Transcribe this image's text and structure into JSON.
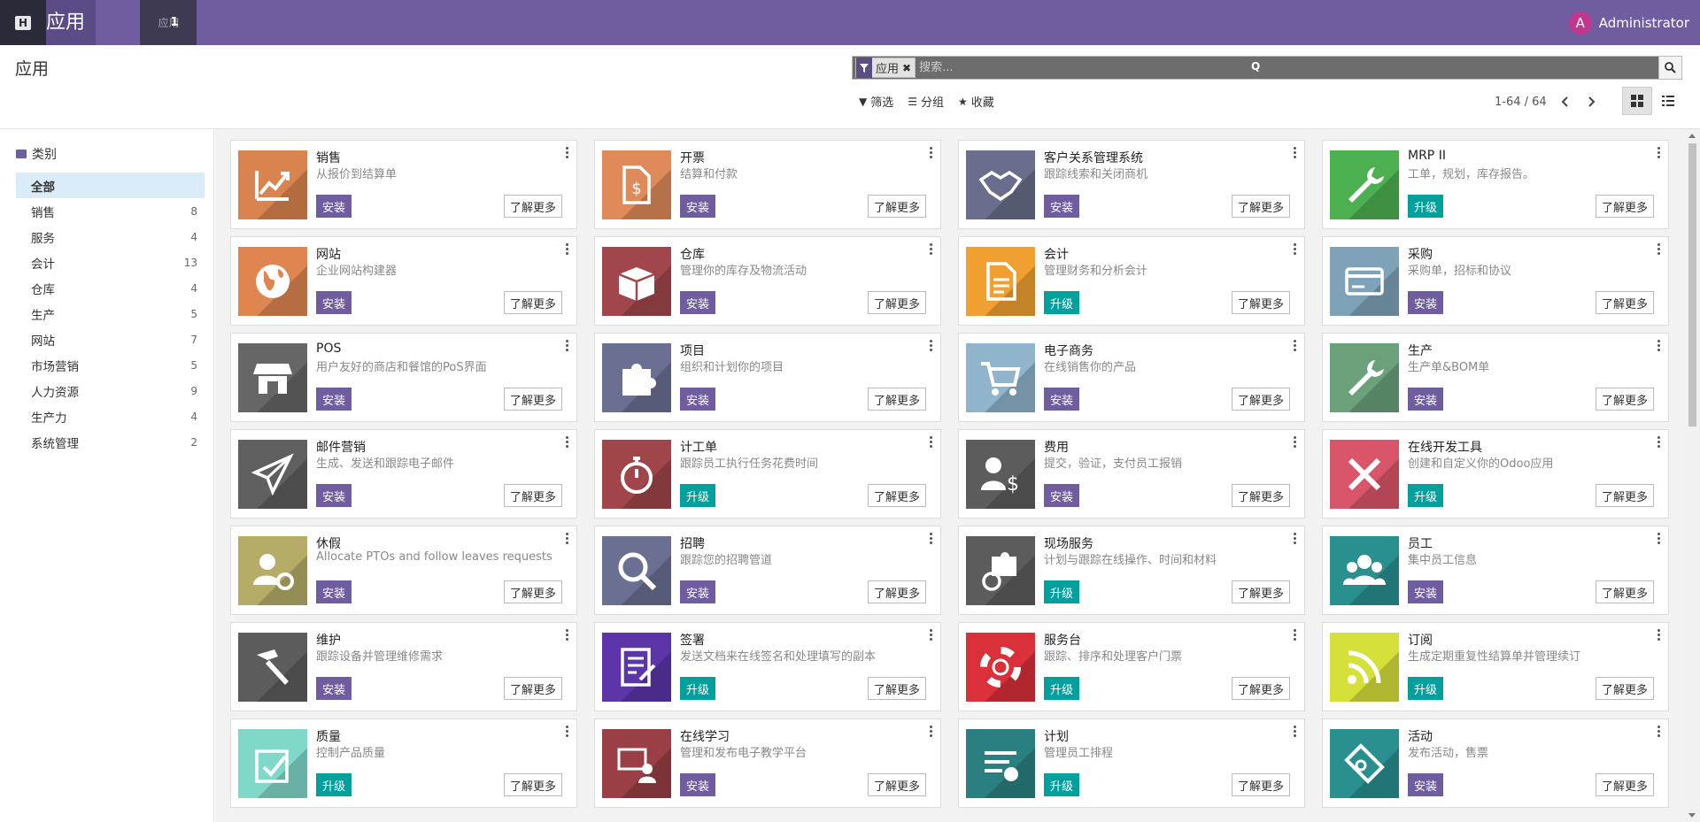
{
  "navbar": {
    "home_icon": "H",
    "title": "应用",
    "tab_label": "应用",
    "tab_badge": "1",
    "user_initial": "A",
    "user_name": "Administrator"
  },
  "control": {
    "page_title": "应用",
    "facet_label": "应用",
    "search_placeholder": "搜索...",
    "search_hint": "Q",
    "filters": [
      {
        "label": "筛选",
        "icon": "filter-icon"
      },
      {
        "label": "分组",
        "icon": "list-icon"
      },
      {
        "label": "收藏",
        "icon": "star-icon"
      }
    ],
    "pager": "1-64 / 64"
  },
  "sidebar": {
    "heading": "类别",
    "items": [
      {
        "label": "全部",
        "count": ""
      },
      {
        "label": "销售",
        "count": "8"
      },
      {
        "label": "服务",
        "count": "4"
      },
      {
        "label": "会计",
        "count": "13"
      },
      {
        "label": "仓库",
        "count": "4"
      },
      {
        "label": "生产",
        "count": "5"
      },
      {
        "label": "网站",
        "count": "7"
      },
      {
        "label": "市场营销",
        "count": "5"
      },
      {
        "label": "人力资源",
        "count": "9"
      },
      {
        "label": "生产力",
        "count": "4"
      },
      {
        "label": "系统管理",
        "count": "2"
      }
    ]
  },
  "apps": [
    {
      "name": "销售",
      "desc": "从报价到结算单",
      "action": "安装",
      "type": "install",
      "more": "了解更多",
      "color": "#d9844e",
      "icon": "chart-icon"
    },
    {
      "name": "开票",
      "desc": "结算和付款",
      "action": "安装",
      "type": "install",
      "more": "了解更多",
      "color": "#e08a5a",
      "icon": "invoice-icon"
    },
    {
      "name": "客户关系管理系统",
      "desc": "跟踪线索和关闭商机",
      "action": "安装",
      "type": "install",
      "more": "了解更多",
      "color": "#6a6d8c",
      "icon": "handshake-icon"
    },
    {
      "name": "MRP II",
      "desc": "工单，规划，库存报告。",
      "action": "升级",
      "type": "upgrade",
      "more": "了解更多",
      "color": "#4caf50",
      "icon": "wrench-icon"
    },
    {
      "name": "网站",
      "desc": "企业网站构建器",
      "action": "安装",
      "type": "install",
      "more": "了解更多",
      "color": "#de8550",
      "icon": "globe-icon"
    },
    {
      "name": "仓库",
      "desc": "管理你的库存及物流活动",
      "action": "安装",
      "type": "install",
      "more": "了解更多",
      "color": "#a1464a",
      "icon": "box-icon"
    },
    {
      "name": "会计",
      "desc": "管理财务和分析会计",
      "action": "升级",
      "type": "upgrade",
      "more": "了解更多",
      "color": "#f0a030",
      "icon": "document-icon"
    },
    {
      "name": "采购",
      "desc": "采购单，招标和协议",
      "action": "安装",
      "type": "install",
      "more": "了解更多",
      "color": "#7ea3b8",
      "icon": "card-icon"
    },
    {
      "name": "POS",
      "desc": "用户友好的商店和餐馆的PoS界面",
      "action": "安装",
      "type": "install",
      "more": "了解更多",
      "color": "#666",
      "icon": "shop-icon"
    },
    {
      "name": "项目",
      "desc": "组织和计划你的项目",
      "action": "安装",
      "type": "install",
      "more": "了解更多",
      "color": "#6b6f92",
      "icon": "puzzle-icon"
    },
    {
      "name": "电子商务",
      "desc": "在线销售你的产品",
      "action": "安装",
      "type": "install",
      "more": "了解更多",
      "color": "#8fb4cc",
      "icon": "cart-icon"
    },
    {
      "name": "生产",
      "desc": "生产单&BOM单",
      "action": "安装",
      "type": "install",
      "more": "了解更多",
      "color": "#6aa07a",
      "icon": "wrench-icon"
    },
    {
      "name": "邮件营销",
      "desc": "生成、发送和跟踪电子邮件",
      "action": "安装",
      "type": "install",
      "more": "了解更多",
      "color": "#5f5f5f",
      "icon": "paper-plane-icon"
    },
    {
      "name": "计工单",
      "desc": "跟踪员工执行任务花费时间",
      "action": "升级",
      "type": "upgrade",
      "more": "了解更多",
      "color": "#a0464a",
      "icon": "stopwatch-icon"
    },
    {
      "name": "费用",
      "desc": "提交，验证，支付员工报销",
      "action": "安装",
      "type": "install",
      "more": "了解更多",
      "color": "#5c5c5c",
      "icon": "user-dollar-icon"
    },
    {
      "name": "在线开发工具",
      "desc": "创建和自定义你的Odoo应用",
      "action": "升级",
      "type": "upgrade",
      "more": "了解更多",
      "color": "#d9556a",
      "icon": "tools-icon"
    },
    {
      "name": "休假",
      "desc": "Allocate PTOs and follow leaves requests",
      "action": "安装",
      "type": "install",
      "more": "了解更多",
      "color": "#b5ac68",
      "icon": "user-gear-icon"
    },
    {
      "name": "招聘",
      "desc": "跟踪您的招聘管道",
      "action": "安装",
      "type": "install",
      "more": "了解更多",
      "color": "#6b6f92",
      "icon": "magnifier-icon"
    },
    {
      "name": "现场服务",
      "desc": "计划与跟踪在线操作、时间和材料",
      "action": "升级",
      "type": "upgrade",
      "more": "了解更多",
      "color": "#5c5c5c",
      "icon": "puzzle-clock-icon"
    },
    {
      "name": "员工",
      "desc": "集中员工信息",
      "action": "安装",
      "type": "install",
      "more": "了解更多",
      "color": "#2a8f8f",
      "icon": "group-icon"
    },
    {
      "name": "维护",
      "desc": "跟踪设备并管理维修需求",
      "action": "安装",
      "type": "install",
      "more": "了解更多",
      "color": "#5c5c5c",
      "icon": "hammer-icon"
    },
    {
      "name": "签署",
      "desc": "发送文档来在线签名和处理填写的副本",
      "action": "升级",
      "type": "upgrade",
      "more": "了解更多",
      "color": "#5c35a8",
      "icon": "sign-icon"
    },
    {
      "name": "服务台",
      "desc": "跟踪、排序和处理客户门票",
      "action": "升级",
      "type": "upgrade",
      "more": "了解更多",
      "color": "#d9303a",
      "icon": "lifebuoy-icon"
    },
    {
      "name": "订阅",
      "desc": "生成定期重复性结算单并管理续订",
      "action": "升级",
      "type": "upgrade",
      "more": "了解更多",
      "color": "#d6e03a",
      "icon": "rss-icon"
    },
    {
      "name": "质量",
      "desc": "控制产品质量",
      "action": "升级",
      "type": "upgrade",
      "more": "了解更多",
      "color": "#7fd8c8",
      "icon": "quality-icon"
    },
    {
      "name": "在线学习",
      "desc": "管理和发布电子教学平台",
      "action": "安装",
      "type": "install",
      "more": "了解更多",
      "color": "#9a3f45",
      "icon": "teacher-icon"
    },
    {
      "name": "计划",
      "desc": "管理员工排程",
      "action": "升级",
      "type": "upgrade",
      "more": "了解更多",
      "color": "#2a8080",
      "icon": "planning-icon"
    },
    {
      "name": "活动",
      "desc": "发布活动，售票",
      "action": "安装",
      "type": "install",
      "more": "了解更多",
      "color": "#2a8f8f",
      "icon": "ticket-icon"
    }
  ]
}
